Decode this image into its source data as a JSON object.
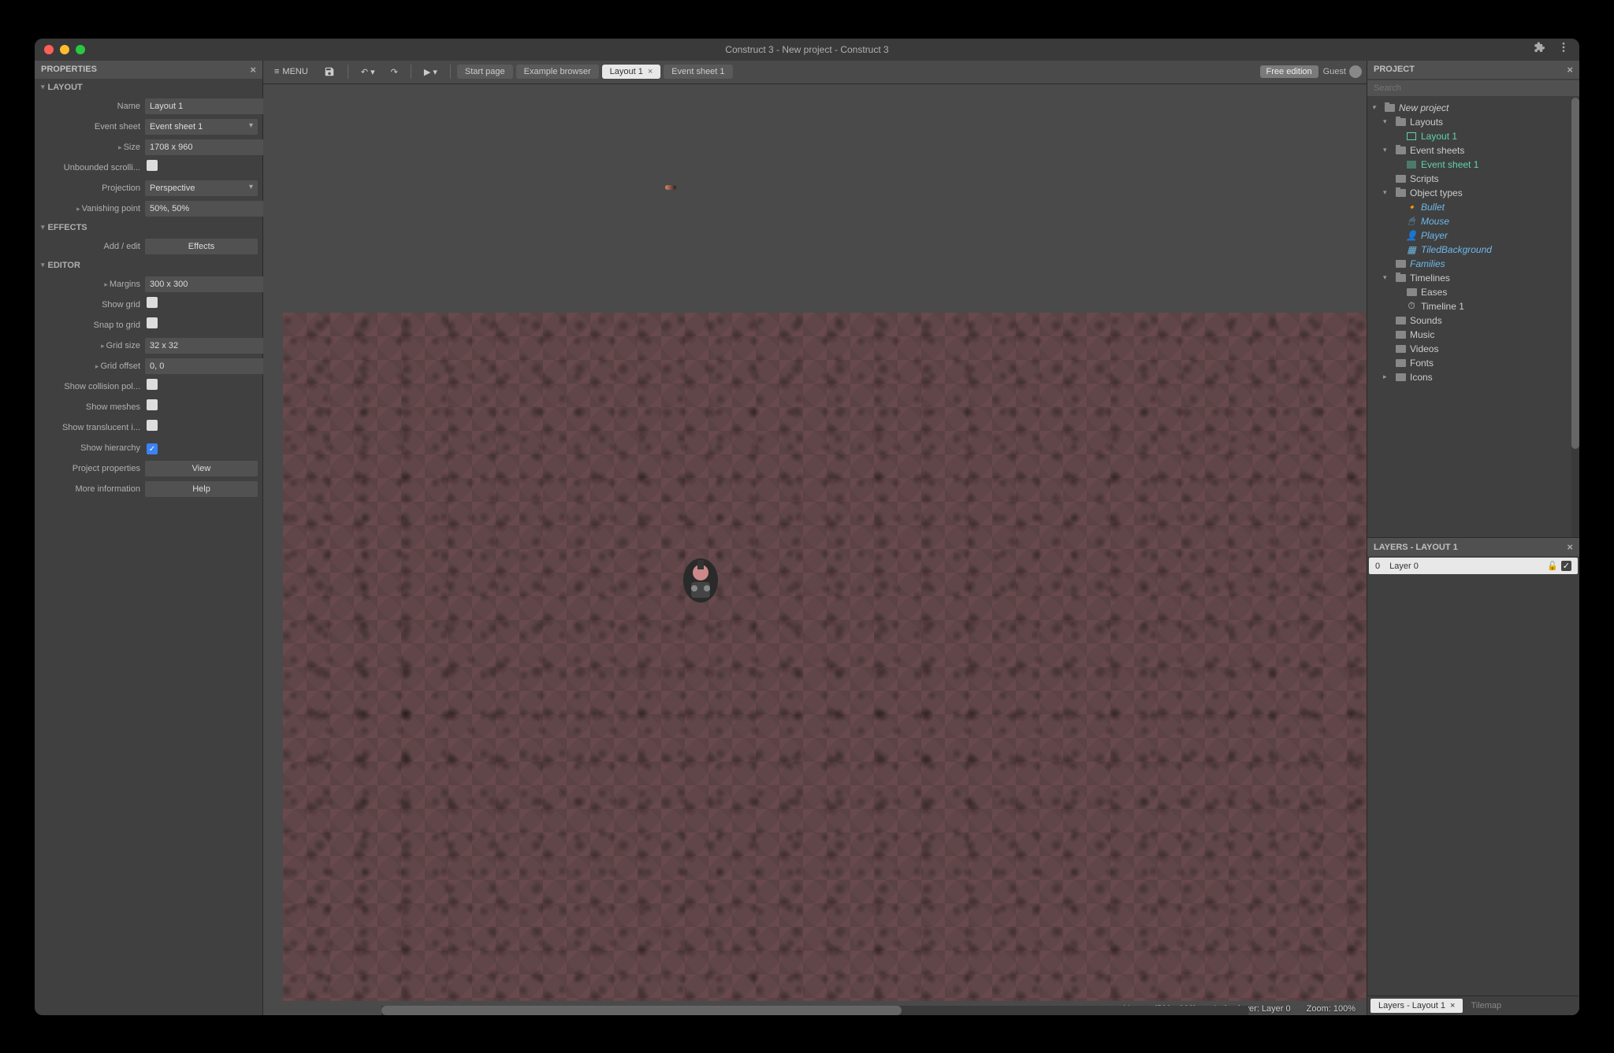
{
  "window": {
    "title": "Construct 3 - New project - Construct 3"
  },
  "toolbar": {
    "menu_label": "MENU",
    "free_edition": "Free edition",
    "guest_label": "Guest",
    "tabs": [
      {
        "label": "Start page",
        "closable": false,
        "active": false
      },
      {
        "label": "Example browser",
        "closable": false,
        "active": false
      },
      {
        "label": "Layout 1",
        "closable": true,
        "active": true
      },
      {
        "label": "Event sheet 1",
        "closable": false,
        "active": false
      }
    ]
  },
  "properties": {
    "panel_title": "PROPERTIES",
    "sections": {
      "layout": {
        "title": "LAYOUT",
        "name_label": "Name",
        "name_value": "Layout 1",
        "eventsheet_label": "Event sheet",
        "eventsheet_value": "Event sheet 1",
        "size_label": "Size",
        "size_value": "1708 x 960",
        "unbounded_label": "Unbounded scrolli...",
        "projection_label": "Projection",
        "projection_value": "Perspective",
        "vanishing_label": "Vanishing point",
        "vanishing_value": "50%, 50%"
      },
      "effects": {
        "title": "EFFECTS",
        "addedit_label": "Add / edit",
        "effects_button": "Effects"
      },
      "editor": {
        "title": "EDITOR",
        "margins_label": "Margins",
        "margins_value": "300 x 300",
        "showgrid_label": "Show grid",
        "snapgrid_label": "Snap to grid",
        "gridsize_label": "Grid size",
        "gridsize_value": "32 x 32",
        "gridoffset_label": "Grid offset",
        "gridoffset_value": "0, 0",
        "collision_label": "Show collision pol...",
        "meshes_label": "Show meshes",
        "translucent_label": "Show translucent i...",
        "hierarchy_label": "Show hierarchy",
        "projprops_label": "Project properties",
        "view_button": "View",
        "moreinfo_label": "More information",
        "help_button": "Help"
      }
    }
  },
  "canvas": {
    "status_mouse": "Mouse: (530, -333)",
    "status_layer": "Active layer: Layer 0",
    "status_zoom": "Zoom: 100%"
  },
  "project": {
    "panel_title": "PROJECT",
    "search_placeholder": "Search",
    "root": "New project",
    "layouts_label": "Layouts",
    "layout_1": "Layout 1",
    "eventsheets_label": "Event sheets",
    "eventsheet_1": "Event sheet 1",
    "scripts_label": "Scripts",
    "objtypes_label": "Object types",
    "bullet": "Bullet",
    "mouse": "Mouse",
    "player": "Player",
    "tiledbg": "TiledBackground",
    "families_label": "Families",
    "timelines_label": "Timelines",
    "eases_label": "Eases",
    "timeline1": "Timeline 1",
    "sounds_label": "Sounds",
    "music_label": "Music",
    "videos_label": "Videos",
    "fonts_label": "Fonts",
    "icons_label": "Icons"
  },
  "layers": {
    "panel_title": "LAYERS - LAYOUT 1",
    "layer0_index": "0",
    "layer0_name": "Layer 0",
    "tab_active": "Layers - Layout 1",
    "tab_tilemap": "Tilemap"
  }
}
